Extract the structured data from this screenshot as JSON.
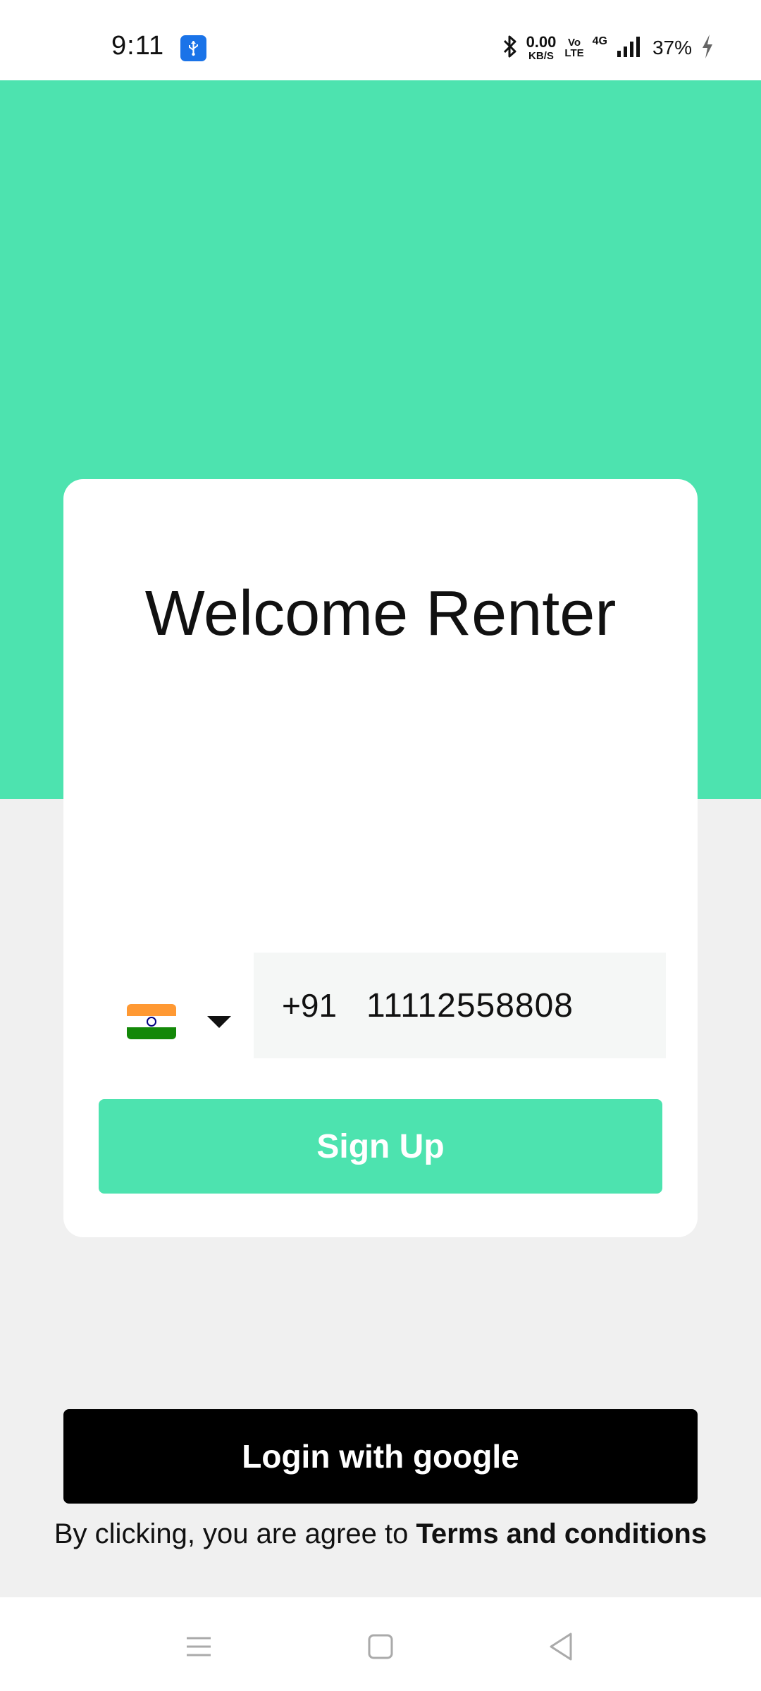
{
  "status_bar": {
    "time": "9:11",
    "net_speed": "0.00",
    "net_speed_unit": "KB/S",
    "volte_top": "Vo",
    "volte_bottom": "LTE",
    "network_type": "4G",
    "battery": "37%",
    "icons": [
      "usb-icon",
      "bluetooth-icon",
      "signal-icon",
      "charging-icon"
    ]
  },
  "card": {
    "title": "Welcome Renter",
    "country_flag": "india-flag",
    "phone_code": "+91",
    "phone_number": "11112558808",
    "signup_label": "Sign Up"
  },
  "google_login": {
    "label": "Login with google"
  },
  "terms": {
    "prefix": "By clicking, you are agree to ",
    "link": "Terms and conditions"
  },
  "colors": {
    "accent": "#4de3af",
    "google_button": "#000000",
    "background": "#f0f0f0"
  },
  "nav_bar": {
    "icons": [
      "menu-icon",
      "home-icon",
      "back-icon"
    ]
  }
}
